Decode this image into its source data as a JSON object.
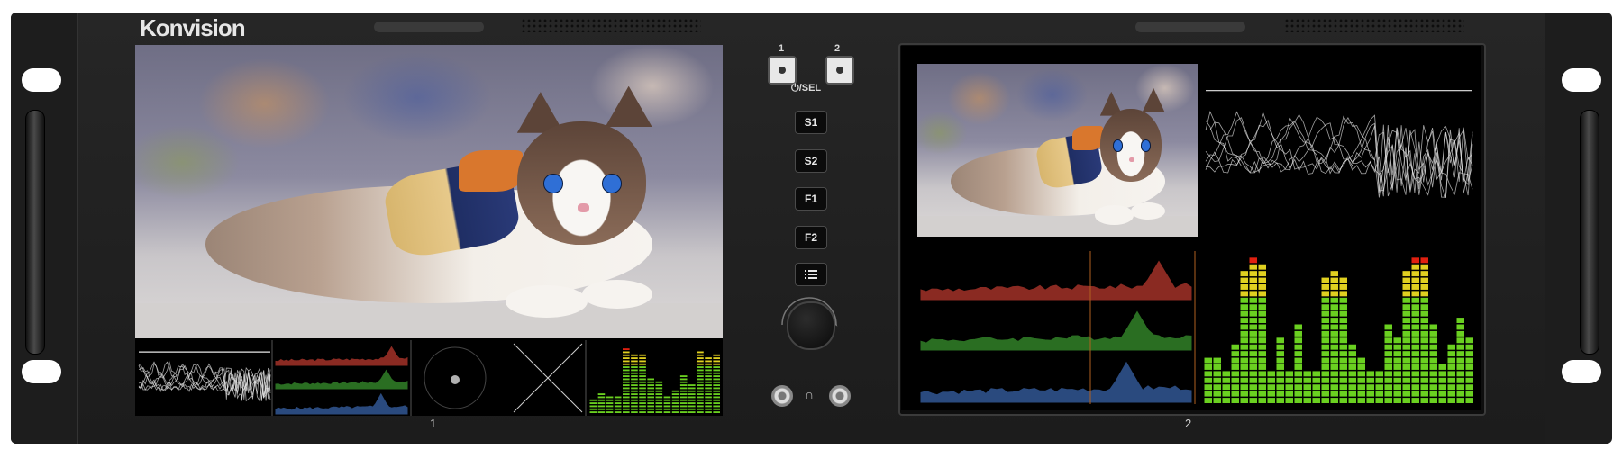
{
  "brand": {
    "logo_text": "Konvision"
  },
  "controls": {
    "channel_1_label": "1",
    "channel_2_label": "2",
    "power_select_label": "⏻/SEL",
    "buttons": [
      "S1",
      "S2",
      "F1",
      "F2"
    ],
    "menu_button_icon": "menu-list-icon",
    "headphone_icon": "headphone-icon"
  },
  "monitor_1": {
    "label": "1"
  },
  "monitor_2": {
    "label": "2"
  },
  "colors": {
    "chassis": "#222222",
    "waveform": "#e8e8e8",
    "histogram_red": "#8a2a22",
    "histogram_green": "#2a6e22",
    "histogram_blue": "#2a4a7e",
    "audio_green": "#6ad020",
    "audio_yellow": "#e0d020",
    "audio_red": "#e02010"
  }
}
